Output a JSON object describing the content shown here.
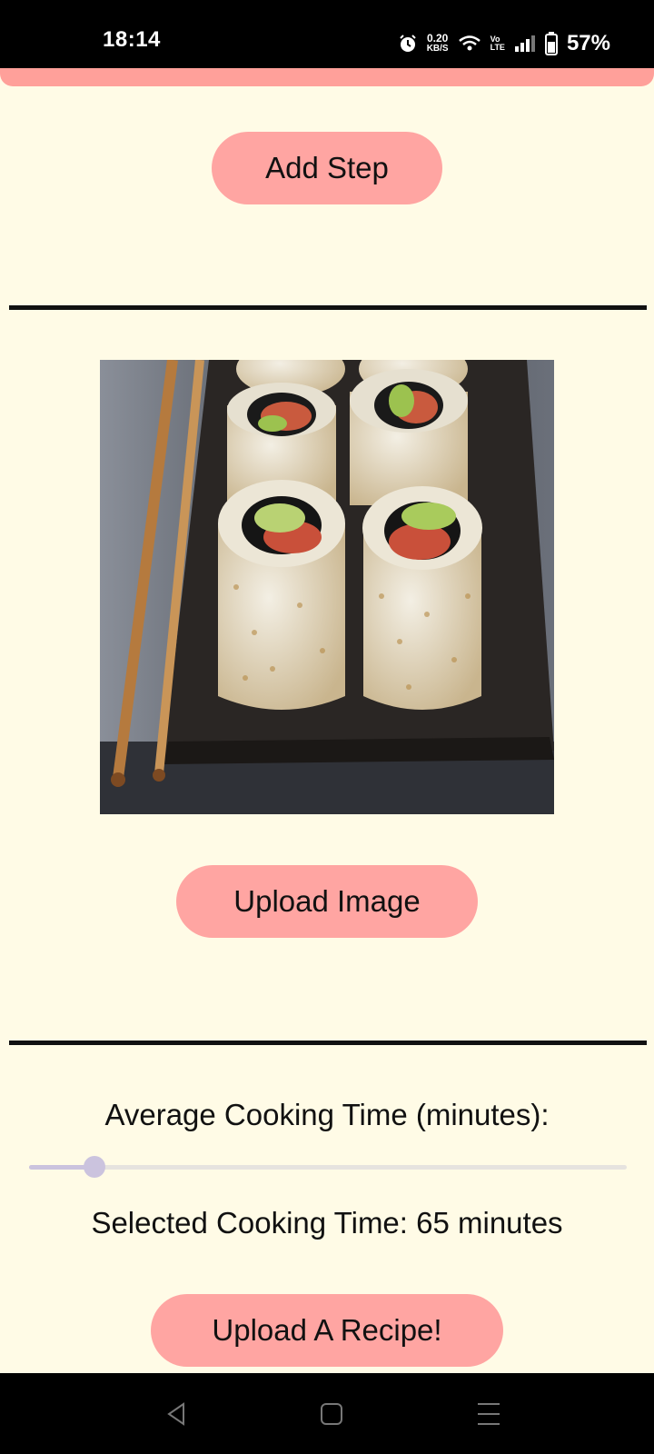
{
  "status_bar": {
    "time": "18:14",
    "net_speed_value": "0.20",
    "net_speed_unit": "KB/S",
    "volte_top": "Vo",
    "volte_bottom": "LTE",
    "battery": "57%"
  },
  "buttons": {
    "add_step": "Add Step",
    "upload_image": "Upload Image",
    "upload_recipe": "Upload A Recipe!"
  },
  "cooking_time": {
    "label": "Average Cooking Time (minutes):",
    "selected_text": "Selected Cooking Time: 65 minutes",
    "value": 65,
    "slider_fraction": 0.11
  },
  "image": {
    "icon": "sushi-photo"
  },
  "colors": {
    "background": "#fffbe6",
    "button": "#ffa5a2",
    "slider": "#cbc3de"
  }
}
